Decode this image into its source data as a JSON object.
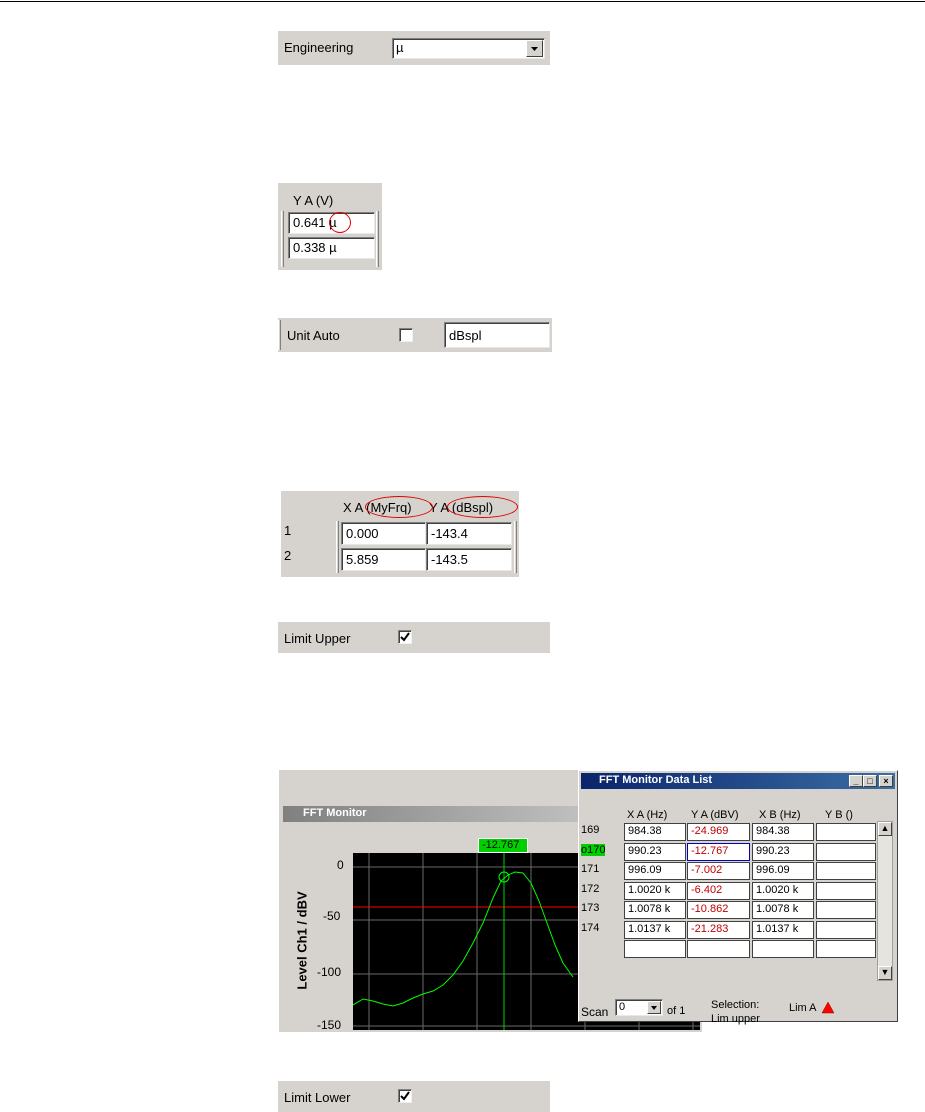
{
  "engineering": {
    "label": "Engineering",
    "value": "µ"
  },
  "ya_volt": {
    "header": "Y A (V)",
    "row1": "0.641 µ",
    "row2": "0.338 µ"
  },
  "unit_auto": {
    "label": "Unit Auto",
    "checked": false,
    "value": "dBspl"
  },
  "small_table": {
    "header_x": "X A (MyFrq)",
    "header_y": "Y A (dBspl)",
    "rows": [
      {
        "num": "1",
        "x": "0.000",
        "y": "-143.4"
      },
      {
        "num": "2",
        "x": "5.859",
        "y": "-143.5"
      }
    ]
  },
  "limit_upper": {
    "label": "Limit Upper",
    "checked": true
  },
  "limit_lower": {
    "label": "Limit Lower",
    "checked": true
  },
  "fft_monitor": {
    "title": "FFT Monitor",
    "ylabel": "Level Ch1 / dBV",
    "yticks": [
      "0",
      "-50",
      "-100",
      "-150"
    ],
    "cursor_value": "-12.767"
  },
  "data_list": {
    "title": "FFT Monitor Data List",
    "columns": [
      "X A (Hz)",
      "Y A (dBV)",
      "X B (Hz)",
      "Y B ()"
    ],
    "rows": [
      {
        "num": "169",
        "xa": "984.38",
        "ya": "-24.969",
        "xb": "984.38",
        "yb": ""
      },
      {
        "num": "o170",
        "xa": "990.23",
        "ya": "-12.767",
        "xb": "990.23",
        "yb": ""
      },
      {
        "num": "171",
        "xa": "996.09",
        "ya": "-7.002",
        "xb": "996.09",
        "yb": ""
      },
      {
        "num": "172",
        "xa": "1.0020 k",
        "ya": "-6.402",
        "xb": "1.0020 k",
        "yb": ""
      },
      {
        "num": "173",
        "xa": "1.0078 k",
        "ya": "-10.862",
        "xb": "1.0078 k",
        "yb": ""
      },
      {
        "num": "174",
        "xa": "1.0137 k",
        "ya": "-21.283",
        "xb": "1.0137 k",
        "yb": ""
      },
      {
        "num": "",
        "xa": "",
        "ya": "",
        "xb": "",
        "yb": ""
      }
    ],
    "scan_label": "Scan",
    "scan_value": "0",
    "scan_of": "of 1",
    "selection_label": "Selection:",
    "selection_value": "Lim upper",
    "lim_label": "Lim A",
    "colors": {
      "title_bar": "#0a246a",
      "highlight": "#00d000",
      "trace": "#00ff00",
      "limit": "#ff0000"
    }
  }
}
